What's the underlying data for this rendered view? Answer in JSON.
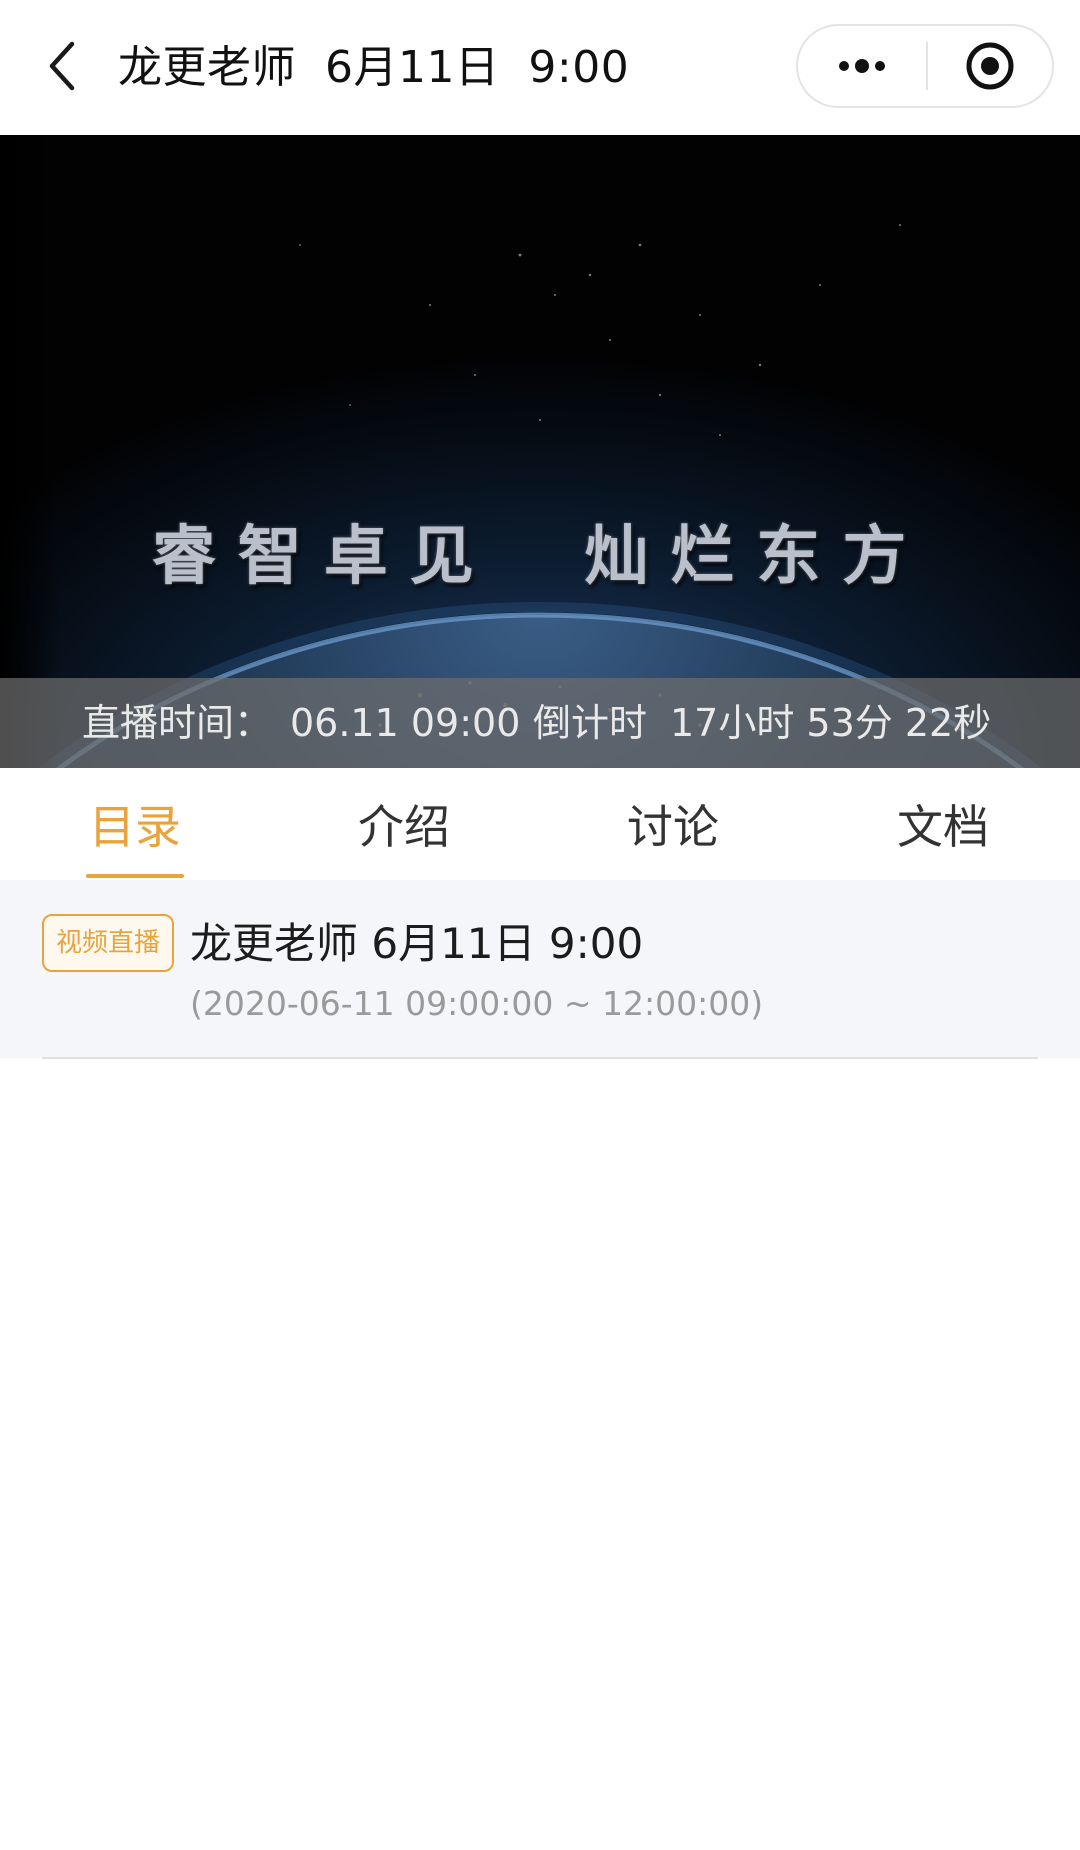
{
  "header": {
    "title": "龙更老师  6月11日  9:00",
    "back_icon": "chevron-left-icon",
    "more_icon": "more-dots-icon",
    "close_icon": "miniprogram-close-icon"
  },
  "player": {
    "slogan": "睿智卓见  灿烂东方",
    "countdown_label": "直播时间：",
    "start_time": "06.11 09:00",
    "countdown_prefix": "倒计时",
    "countdown_value": "17小时 53分 22秒"
  },
  "tabs": [
    {
      "label": "目录",
      "active": true
    },
    {
      "label": "介绍",
      "active": false
    },
    {
      "label": "讨论",
      "active": false
    },
    {
      "label": "文档",
      "active": false
    }
  ],
  "catalog": [
    {
      "badge": "视频直播",
      "title": "龙更老师 6月11日 9:00",
      "time_range": "(2020-06-11 09:00:00 ~ 12:00:00)"
    }
  ],
  "colors": {
    "accent": "#e8a33c",
    "list_background": "#f5f6fa",
    "text_primary": "#1c1c1c",
    "text_secondary": "#9a9a9a"
  }
}
